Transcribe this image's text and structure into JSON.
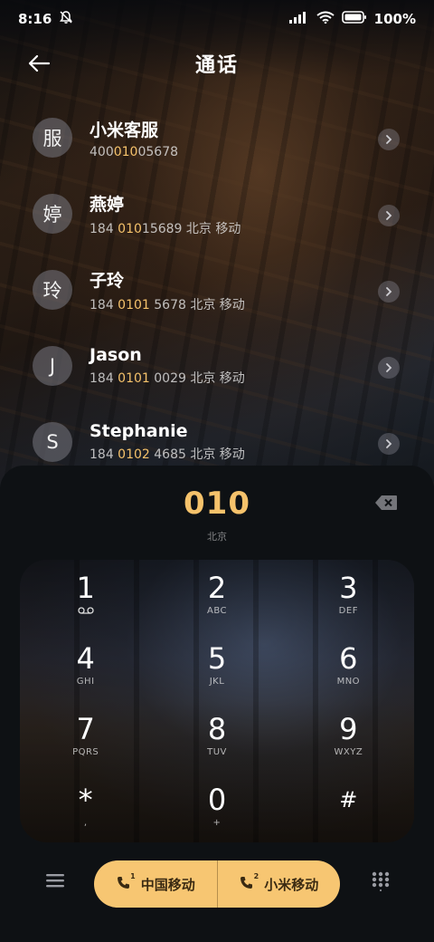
{
  "status_bar": {
    "time": "8:16",
    "battery": "100%"
  },
  "header": {
    "title": "通话"
  },
  "contacts": [
    {
      "avatar": "服",
      "name": "小米客服",
      "pre": "400",
      "hl": "010",
      "post": "05678"
    },
    {
      "avatar": "婷",
      "name": "燕婷",
      "pre": "184 ",
      "hl": "010",
      "post": "15689 北京 移动"
    },
    {
      "avatar": "玲",
      "name": "子玲",
      "pre": "184 ",
      "hl": "0101",
      "post": " 5678 北京 移动"
    },
    {
      "avatar": "J",
      "name": "Jason",
      "pre": "184 ",
      "hl": "0101",
      "post": " 0029 北京 移动"
    },
    {
      "avatar": "S",
      "name": "Stephanie",
      "pre": "184 ",
      "hl": "0102",
      "post": " 4685 北京 移动"
    }
  ],
  "dialer": {
    "number": "010",
    "location": "北京"
  },
  "keys": [
    {
      "digit": "1",
      "letters": "voicemail"
    },
    {
      "digit": "2",
      "letters": "ABC"
    },
    {
      "digit": "3",
      "letters": "DEF"
    },
    {
      "digit": "4",
      "letters": "GHI"
    },
    {
      "digit": "5",
      "letters": "JKL"
    },
    {
      "digit": "6",
      "letters": "MNO"
    },
    {
      "digit": "7",
      "letters": "PQRS"
    },
    {
      "digit": "8",
      "letters": "TUV"
    },
    {
      "digit": "9",
      "letters": "WXYZ"
    },
    {
      "digit": "*",
      "letters": ","
    },
    {
      "digit": "0",
      "letters": "+"
    },
    {
      "digit": "#",
      "letters": ""
    }
  ],
  "call_buttons": {
    "sim1": "中国移动",
    "sim2": "小米移动"
  },
  "colors": {
    "accent": "#f5c26b",
    "call_button_bg": "#f7c672"
  }
}
